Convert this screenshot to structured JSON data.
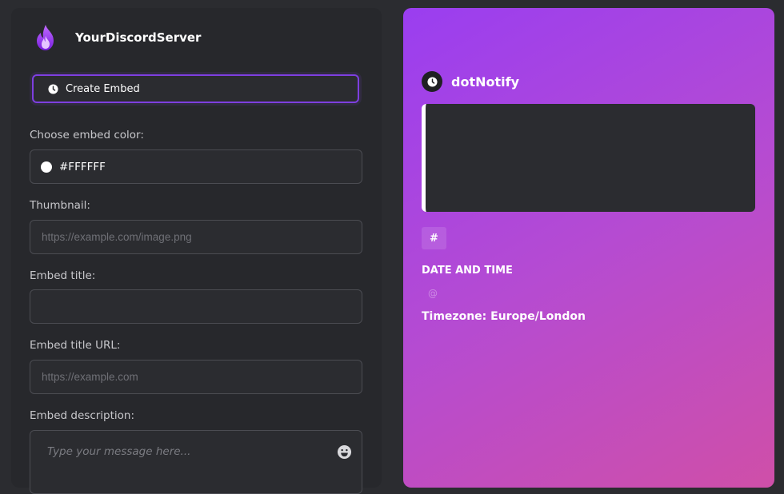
{
  "server": {
    "name": "YourDiscordServer",
    "logo_icon": "flame-icon"
  },
  "create_embed": {
    "label": "Create Embed",
    "icon": "clock-icon"
  },
  "form": {
    "color": {
      "label": "Choose embed color:",
      "value": "#FFFFFF"
    },
    "thumbnail": {
      "label": "Thumbnail:",
      "value": "",
      "placeholder": "https://example.com/image.png"
    },
    "title": {
      "label": "Embed title:",
      "value": "",
      "placeholder": ""
    },
    "title_url": {
      "label": "Embed title URL:",
      "value": "",
      "placeholder": "https://example.com"
    },
    "description": {
      "label": "Embed description:",
      "placeholder": "Type your message here...",
      "icon": "emoji-icon"
    }
  },
  "preview": {
    "bot_name": "dotNotify",
    "bot_icon": "clock-icon",
    "embed_color": "#FFFFFF",
    "channel_chip": "#",
    "date_time_label": "DATE AND TIME",
    "at_symbol": "@",
    "timezone_text": "Timezone: Europe/London"
  },
  "colors": {
    "accent": "#7e3fe0",
    "gradient_start": "#9a3ef0",
    "gradient_end": "#cf4fa8"
  }
}
